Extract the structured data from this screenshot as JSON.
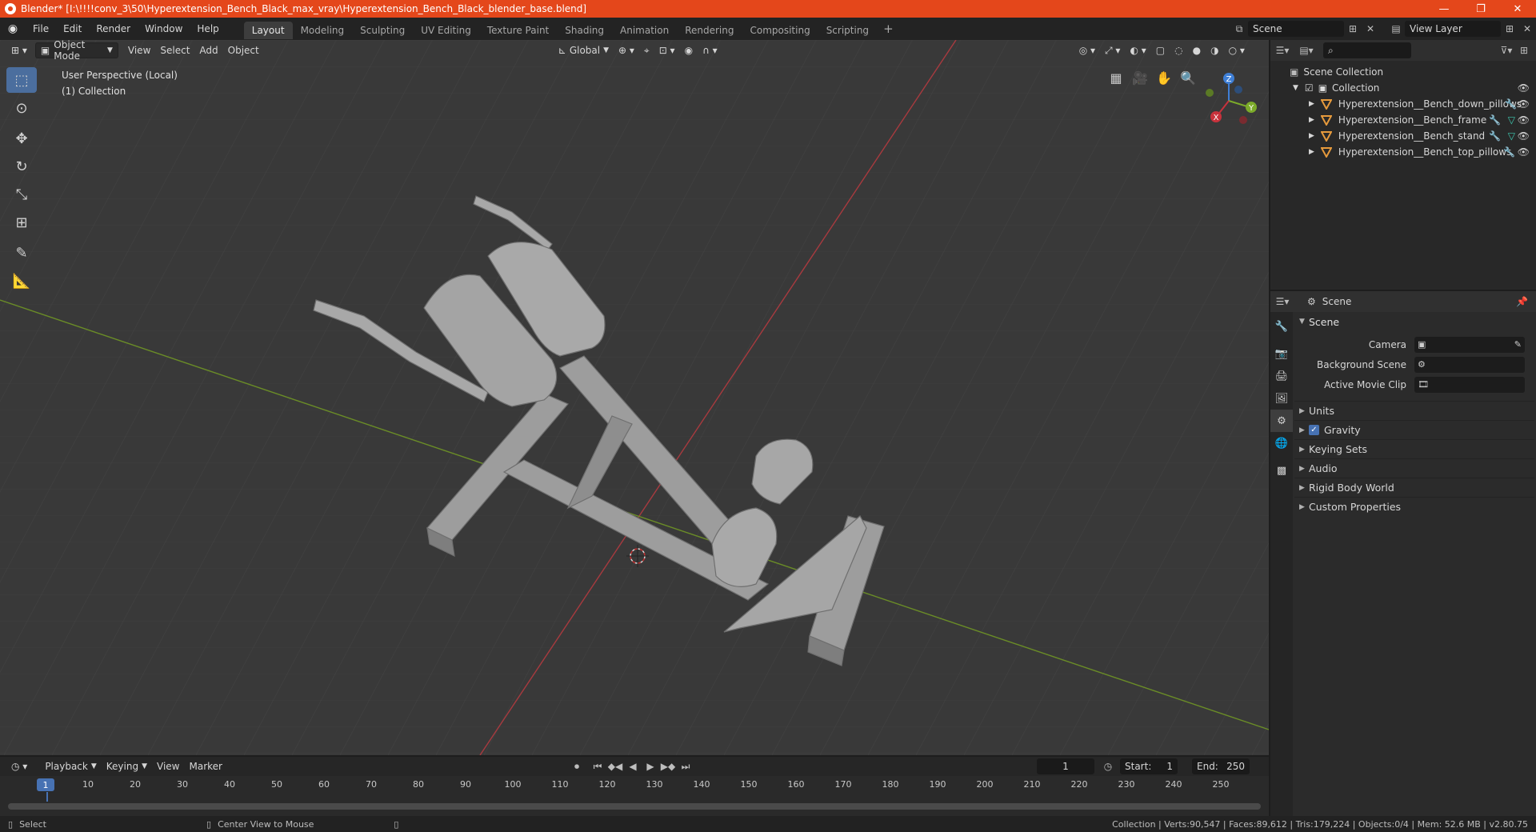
{
  "window": {
    "title": "Blender* [I:\\!!!!conv_3\\50\\Hyperextension_Bench_Black_max_vray\\Hyperextension_Bench_Black_blender_base.blend]",
    "minimize": "—",
    "maximize": "❐",
    "close": "✕"
  },
  "menu": {
    "file": "File",
    "edit": "Edit",
    "render": "Render",
    "window": "Window",
    "help": "Help"
  },
  "workspaces": [
    "Layout",
    "Modeling",
    "Sculpting",
    "UV Editing",
    "Texture Paint",
    "Shading",
    "Animation",
    "Rendering",
    "Compositing",
    "Scripting"
  ],
  "workspace_add": "+",
  "scene_selector": {
    "value": "Scene"
  },
  "view_layer_selector": {
    "value": "View Layer"
  },
  "viewport": {
    "mode": "Object Mode",
    "menus": [
      "View",
      "Select",
      "Add",
      "Object"
    ],
    "orientation": "Global",
    "info_line1": "User Perspective (Local)",
    "info_line2": "(1) Collection",
    "gizmo": {
      "x": "X",
      "y": "Y",
      "z": "Z"
    }
  },
  "outliner": {
    "search_placeholder": "",
    "scene_collection": "Scene Collection",
    "collection": "Collection",
    "objects": [
      "Hyperextension__Bench_down_pillows",
      "Hyperextension__Bench_frame",
      "Hyperextension__Bench_stand",
      "Hyperextension__Bench_top_pillows"
    ]
  },
  "properties": {
    "header": "Scene",
    "scene_panel": "Scene",
    "camera_label": "Camera",
    "background_scene_label": "Background Scene",
    "active_movie_clip_label": "Active Movie Clip",
    "panels": [
      "Units",
      "Gravity",
      "Keying Sets",
      "Audio",
      "Rigid Body World",
      "Custom Properties"
    ],
    "gravity_checked": true
  },
  "timeline": {
    "menus": [
      "Playback",
      "Keying",
      "View",
      "Marker"
    ],
    "current_frame": "1",
    "start_label": "Start:",
    "start_value": "1",
    "end_label": "End:",
    "end_value": "250",
    "ruler": [
      "1",
      "10",
      "20",
      "30",
      "40",
      "50",
      "60",
      "70",
      "80",
      "90",
      "100",
      "110",
      "120",
      "130",
      "140",
      "150",
      "160",
      "170",
      "180",
      "190",
      "200",
      "210",
      "220",
      "230",
      "240",
      "250"
    ]
  },
  "statusbar": {
    "select": "Select",
    "center_view": "Center View to Mouse",
    "stats": "Collection | Verts:90,547 | Faces:89,612 | Tris:179,224 | Objects:0/4 | Mem: 52.6 MB | v2.80.75"
  },
  "colors": {
    "titlebar": "#e4471b",
    "accent_blue": "#4772b3",
    "x_axis": "#c8323c",
    "y_axis": "#7cab2a",
    "z_axis": "#3f7fd6",
    "object_orange": "#e69a3c"
  }
}
